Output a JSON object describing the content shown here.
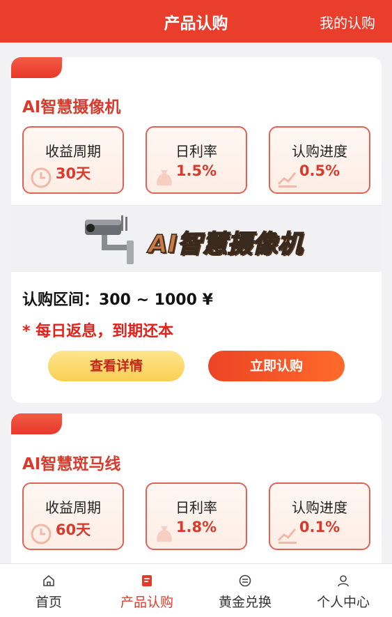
{
  "header": {
    "title": "产品认购",
    "right_link": "我的认购"
  },
  "products": [
    {
      "name": "AI智慧摄像机",
      "stats": [
        {
          "label": "收益周期",
          "value": "30天"
        },
        {
          "label": "日利率",
          "value": "1.5%"
        },
        {
          "label": "认购进度",
          "value": "0.5%"
        }
      ],
      "banner_text": "AI智慧摄像机",
      "range": "认购区间：300 ~ 1000 ¥",
      "note": "* 每日返息，到期还本",
      "detail_button": "查看详情",
      "buy_button": "立即认购"
    },
    {
      "name": "AI智慧斑马线",
      "stats": [
        {
          "label": "收益周期",
          "value": "60天"
        },
        {
          "label": "日利率",
          "value": "1.8%"
        },
        {
          "label": "认购进度",
          "value": "0.1%"
        }
      ]
    }
  ],
  "tabbar": {
    "items": [
      {
        "label": "首页",
        "icon": "home-icon"
      },
      {
        "label": "产品认购",
        "icon": "product-icon"
      },
      {
        "label": "黄金兑换",
        "icon": "exchange-icon"
      },
      {
        "label": "个人中心",
        "icon": "user-icon"
      }
    ],
    "active_index": 1
  },
  "colors": {
    "primary": "#ea3e2c",
    "accent_text": "#d93a2c",
    "detail_button": "#f9cf52",
    "note_red": "#e3211a"
  }
}
